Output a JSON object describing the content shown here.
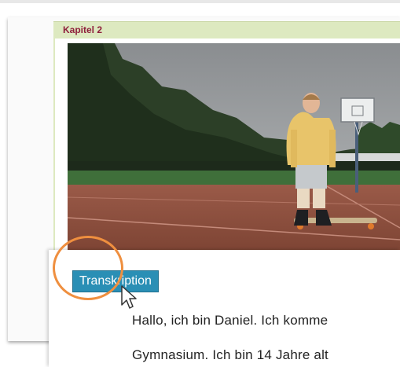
{
  "chapter": {
    "title": "Kapitel 2"
  },
  "video": {
    "description_icon": "video-frame"
  },
  "transcript": {
    "button_label": "Transkription",
    "lines": [
      "Hallo, ich bin Daniel. Ich komme",
      "Gymnasium. Ich bin 14 Jahre alt"
    ]
  },
  "colors": {
    "chapter_bar": "#dde9c0",
    "chapter_text": "#8e1f3b",
    "button": "#2a8fb5",
    "highlight": "#ef8f3f"
  }
}
